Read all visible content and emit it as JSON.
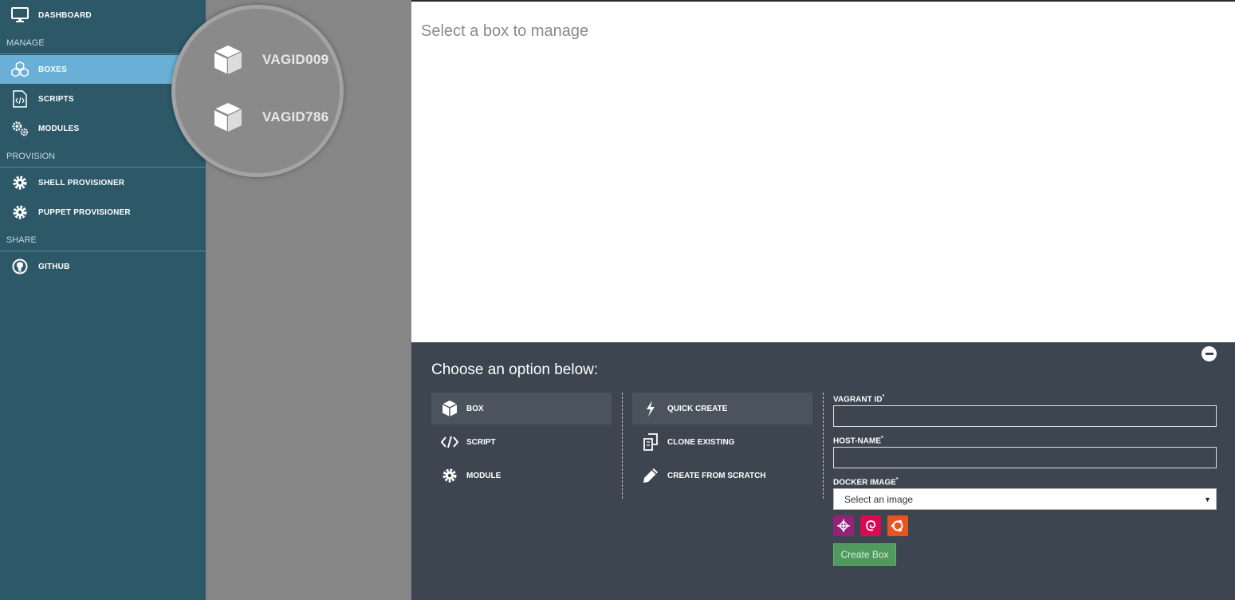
{
  "sidebar": {
    "dashboard": {
      "label": "DASHBOARD",
      "icon": "monitor-icon"
    },
    "sections": {
      "manage": "MANAGE",
      "provision": "PROVISION",
      "share": "SHARE"
    },
    "items": [
      {
        "label": "BOXES",
        "icon": "boxes-icon",
        "active": true
      },
      {
        "label": "SCRIPTS",
        "icon": "script-file-icon"
      },
      {
        "label": "MODULES",
        "icon": "gears-icon"
      },
      {
        "label": "SHELL PROVISIONER",
        "icon": "gear-icon"
      },
      {
        "label": "PUPPET PROVISIONER",
        "icon": "gear-icon"
      },
      {
        "label": "GITHUB",
        "icon": "github-icon"
      }
    ]
  },
  "boxes": [
    {
      "name": "VAGID009",
      "icon": "cube-icon"
    },
    {
      "name": "VAGID786",
      "icon": "cube-icon"
    }
  ],
  "main": {
    "title": "Select a box to manage"
  },
  "panel": {
    "title": "Choose an option below:",
    "types": [
      {
        "label": "BOX",
        "icon": "cube-icon",
        "selected": true
      },
      {
        "label": "SCRIPT",
        "icon": "code-icon"
      },
      {
        "label": "MODULE",
        "icon": "gear-icon"
      }
    ],
    "modes": [
      {
        "label": "QUICK CREATE",
        "icon": "lightning-icon",
        "selected": true
      },
      {
        "label": "CLONE EXISTING",
        "icon": "clone-icon"
      },
      {
        "label": "CREATE FROM SCRATCH",
        "icon": "pencil-icon"
      }
    ],
    "form": {
      "vagrant_id_label": "VAGRANT ID",
      "vagrant_id_value": "",
      "host_name_label": "HOST-NAME",
      "host_name_value": "",
      "docker_image_label": "DOCKER IMAGE",
      "docker_image_selected": "Select an image",
      "required_mark": "*",
      "os_icons": [
        {
          "name": "centos-icon",
          "color": "#932279"
        },
        {
          "name": "debian-icon",
          "color": "#d70a53"
        },
        {
          "name": "ubuntu-icon",
          "color": "#e95420"
        }
      ],
      "create_button": "Create Box"
    }
  },
  "colors": {
    "sidebar_bg": "#2c5868",
    "active_item": "#6aafd6",
    "panel_bg": "#3c4550",
    "create_button": "#4f9a5c"
  }
}
